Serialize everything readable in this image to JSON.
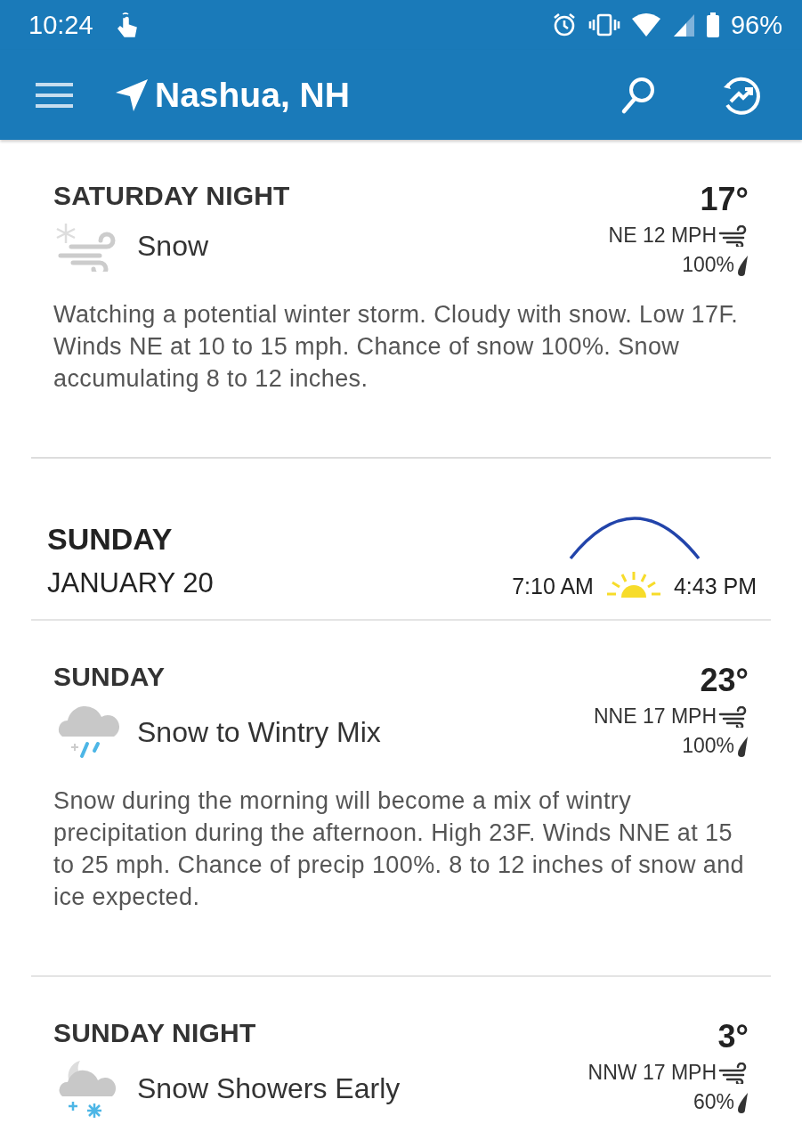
{
  "status_bar": {
    "time": "10:24",
    "battery": "96%"
  },
  "app_bar": {
    "location": "Nashua, NH"
  },
  "sections": [
    {
      "kind": "period",
      "name": "SATURDAY NIGHT",
      "condition": "Snow",
      "temp": "17°",
      "wind": "NE 12 MPH",
      "precip": "100%",
      "description": "Watching a potential winter storm. Cloudy with snow. Low 17F. Winds NE at 10 to 15 mph. Chance of snow 100%. Snow accumulating 8 to 12 inches."
    },
    {
      "kind": "day",
      "weekday": "SUNDAY",
      "date": "JANUARY 20",
      "sunrise": "7:10 AM",
      "sunset": "4:43 PM"
    },
    {
      "kind": "period",
      "name": "SUNDAY",
      "condition": "Snow to Wintry Mix",
      "temp": "23°",
      "wind": "NNE 17 MPH",
      "precip": "100%",
      "description": "Snow during the morning will become a mix of wintry precipitation during the afternoon. High 23F. Winds NNE at 15 to 25 mph. Chance of precip 100%. 8 to 12 inches of snow and ice expected."
    },
    {
      "kind": "period",
      "name": "SUNDAY NIGHT",
      "condition": "Snow Showers Early",
      "temp": "3°",
      "wind": "NNW 17 MPH",
      "precip": "60%"
    }
  ]
}
